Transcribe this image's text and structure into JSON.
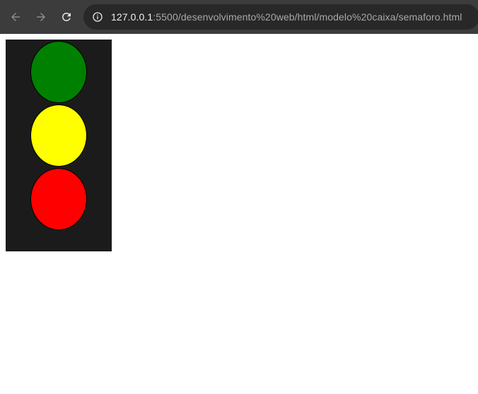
{
  "browser": {
    "url_host": "127.0.0.1",
    "url_path": ":5500/desenvolvimento%20web/html/modelo%20caixa/semaforo.html",
    "nav_icons": [
      "back-arrow-icon",
      "forward-arrow-icon",
      "reload-icon",
      "site-info-icon"
    ]
  },
  "semaforo": {
    "lights": [
      {
        "name": "green",
        "color": "#008000"
      },
      {
        "name": "yellow",
        "color": "#ffff00"
      },
      {
        "name": "red",
        "color": "#ff0000"
      }
    ],
    "housing_color": "#1b1b1b"
  }
}
